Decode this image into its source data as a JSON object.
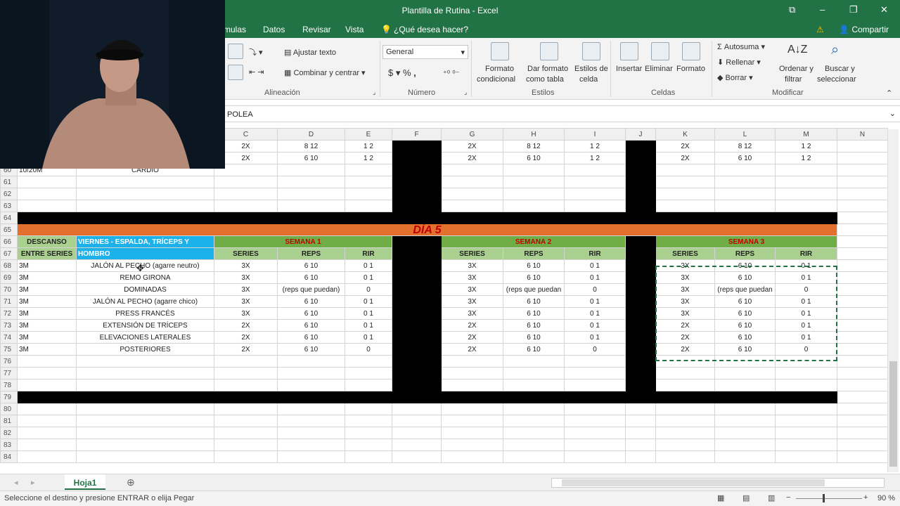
{
  "window": {
    "title": "Plantilla de Rutina - Excel",
    "share": "Compartir",
    "search": "¿Qué desea hacer?"
  },
  "tabs": [
    "mulas",
    "Datos",
    "Revisar",
    "Vista"
  ],
  "ribbon": {
    "wrap": "Ajustar texto",
    "merge": "Combinar y centrar",
    "align_group": "Alineación",
    "num_format": "General",
    "number_group": "Número",
    "cond_fmt": "Formato",
    "cond_fmt2": "condicional",
    "fmt_table": "Dar formato",
    "fmt_table2": "como tabla",
    "cell_styles": "Estilos de",
    "cell_styles2": "celda",
    "styles_group": "Estilos",
    "insert": "Insertar",
    "delete": "Eliminar",
    "format": "Formato",
    "cells_group": "Celdas",
    "autosum": "Autosuma",
    "fill": "Rellenar",
    "clear": "Borrar",
    "sort": "Ordenar y",
    "sort2": "filtrar",
    "find": "Buscar y",
    "find2": "seleccionar",
    "modify_group": "Modificar"
  },
  "formula_text": "N POLEA",
  "columns": [
    "C",
    "D",
    "E",
    "F",
    "G",
    "H",
    "I",
    "J",
    "K",
    "L",
    "M",
    "N"
  ],
  "top_rows": [
    [
      "2X",
      "8 12",
      "1 2",
      "2X",
      "8 12",
      "1 2",
      "2X",
      "8 12",
      "1 2"
    ],
    [
      "2X",
      "6 10",
      "1 2",
      "2X",
      "6 10",
      "1 2",
      "2X",
      "6 10",
      "1 2"
    ]
  ],
  "row60": {
    "a": "10/20M",
    "b": "CARDIO"
  },
  "day": "DÍA 5",
  "headers": {
    "descanso": "DESCANSO",
    "entre": "ENTRE SERIES",
    "day_title": "VIERNES - ESPALDA, TRÍCEPS Y",
    "day_title2": "HOMBRO",
    "w1": "SEMANA 1",
    "w2": "SEMANA 2",
    "w3": "SEMANA 3",
    "series": "SERIES",
    "reps": "REPS",
    "rir": "RIR"
  },
  "exercises": [
    {
      "rest": "3M",
      "name": "JALÓN AL PECHO (agarre neutro)",
      "w1": [
        "3X",
        "6 10",
        "0 1"
      ],
      "w2": [
        "3X",
        "6 10",
        "0 1"
      ],
      "w3": [
        "3X",
        "6 10",
        "0 1"
      ]
    },
    {
      "rest": "3M",
      "name": "REMO GIRONA",
      "w1": [
        "3X",
        "6 10",
        "0 1"
      ],
      "w2": [
        "3X",
        "6 10",
        "0 1"
      ],
      "w3": [
        "3X",
        "6 10",
        "0 1"
      ]
    },
    {
      "rest": "3M",
      "name": "DOMINADAS",
      "w1": [
        "3X",
        "(reps que puedan)",
        "0"
      ],
      "w2": [
        "3X",
        "(reps que puedan",
        "0"
      ],
      "w3": [
        "3X",
        "(reps que puedan",
        "0"
      ]
    },
    {
      "rest": "3M",
      "name": "JALÓN AL PECHO (agarre chico)",
      "w1": [
        "3X",
        "6 10",
        "0 1"
      ],
      "w2": [
        "3X",
        "6 10",
        "0 1"
      ],
      "w3": [
        "3X",
        "6 10",
        "0 1"
      ]
    },
    {
      "rest": "3M",
      "name": "PRESS FRANCÉS",
      "w1": [
        "3X",
        "6 10",
        "0 1"
      ],
      "w2": [
        "3X",
        "6 10",
        "0 1"
      ],
      "w3": [
        "3X",
        "6 10",
        "0 1"
      ]
    },
    {
      "rest": "3M",
      "name": "EXTENSIÓN DE TRÍCEPS",
      "w1": [
        "2X",
        "6 10",
        "0 1"
      ],
      "w2": [
        "2X",
        "6 10",
        "0 1"
      ],
      "w3": [
        "2X",
        "6 10",
        "0 1"
      ]
    },
    {
      "rest": "3M",
      "name": "ELEVACIONES LATERALES",
      "w1": [
        "2X",
        "6 10",
        "0 1"
      ],
      "w2": [
        "2X",
        "6 10",
        "0 1"
      ],
      "w3": [
        "2X",
        "6 10",
        "0 1"
      ]
    },
    {
      "rest": "3M",
      "name": "POSTERIORES",
      "w1": [
        "2X",
        "6 10",
        "0"
      ],
      "w2": [
        "2X",
        "6 10",
        "0"
      ],
      "w3": [
        "2X",
        "6 10",
        "0"
      ]
    }
  ],
  "sheet": "Hoja1",
  "status": "Seleccione el destino y presione ENTRAR o elija Pegar",
  "zoom": "90 %",
  "colors": {
    "accent": "#217346",
    "day": "#e3702f",
    "week": "#70ad47",
    "title": "#1cb1e9"
  }
}
